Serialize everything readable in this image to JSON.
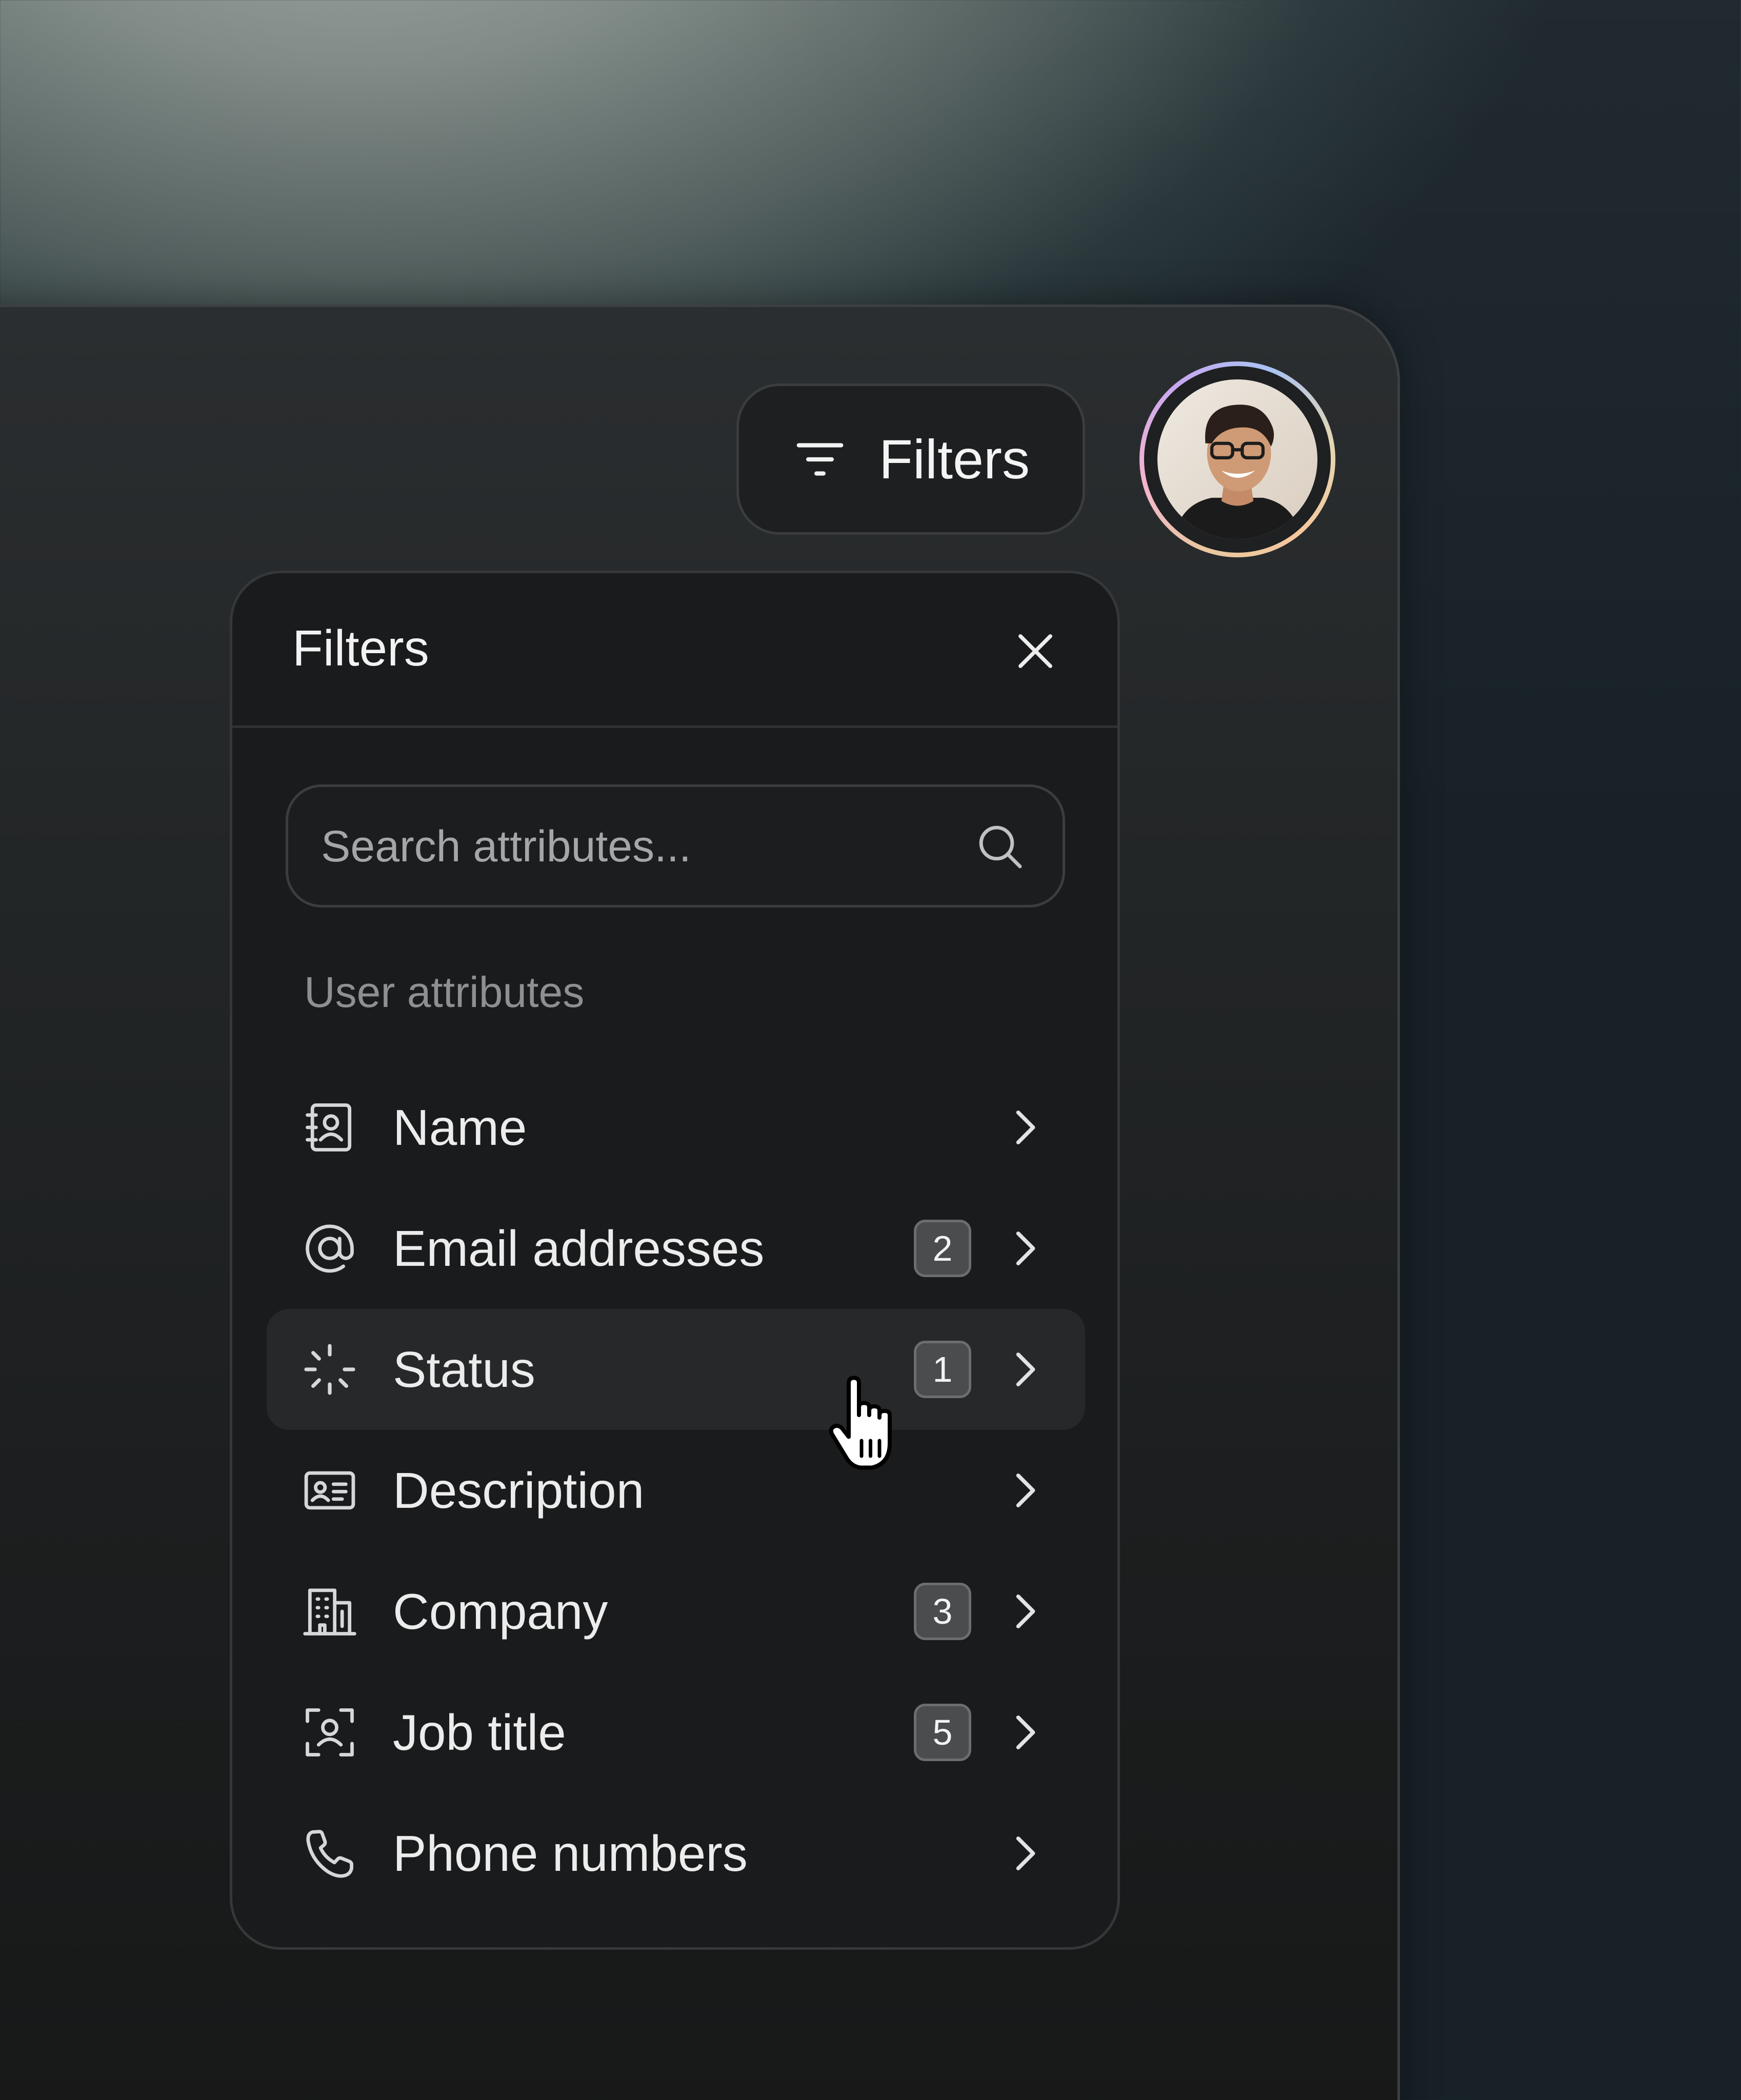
{
  "toolbar": {
    "filters_button_label": "Filters",
    "filters_icon": "filter-lines-icon"
  },
  "avatar": {
    "icon": "user-avatar"
  },
  "panel": {
    "title": "Filters",
    "close_icon": "close-icon",
    "search": {
      "placeholder": "Search attributes...",
      "value": "",
      "icon": "search-icon"
    },
    "section_label": "User attributes",
    "items": [
      {
        "label": "Name",
        "icon": "contact-book-icon",
        "badge": null
      },
      {
        "label": "Email addresses",
        "icon": "at-sign-icon",
        "badge": "2"
      },
      {
        "label": "Status",
        "icon": "loader-icon",
        "badge": "1",
        "hovered": true
      },
      {
        "label": "Description",
        "icon": "id-card-icon",
        "badge": null
      },
      {
        "label": "Company",
        "icon": "building-icon",
        "badge": "3"
      },
      {
        "label": "Job title",
        "icon": "user-focus-icon",
        "badge": "5"
      },
      {
        "label": "Phone numbers",
        "icon": "phone-icon",
        "badge": null
      }
    ]
  },
  "colors": {
    "panel_bg": "#1a1b1c",
    "hover_bg": "#262829",
    "text_primary": "#ececec",
    "text_muted": "#8d9092",
    "badge_bg": "#4a4c4e"
  }
}
